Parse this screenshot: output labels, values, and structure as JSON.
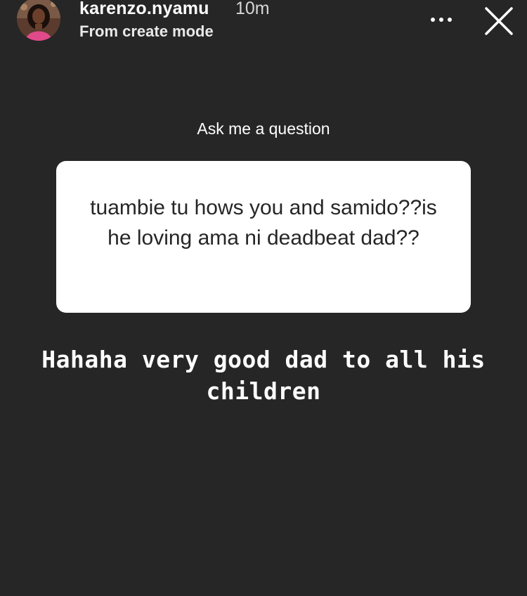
{
  "header": {
    "username": "karenzo.nyamu",
    "time": "10m",
    "subtitle": "From create mode",
    "more_icon": "more-horizontal-icon",
    "close_icon": "close-icon"
  },
  "sticker": {
    "label": "Ask me a question",
    "question": "tuambie tu hows you and samido??is he loving ama ni deadbeat dad??"
  },
  "reply": {
    "text": "Hahaha very good dad to all his children"
  },
  "colors": {
    "background": "#262626",
    "card": "#ffffff",
    "card_text": "#262626",
    "text": "#ffffff"
  }
}
